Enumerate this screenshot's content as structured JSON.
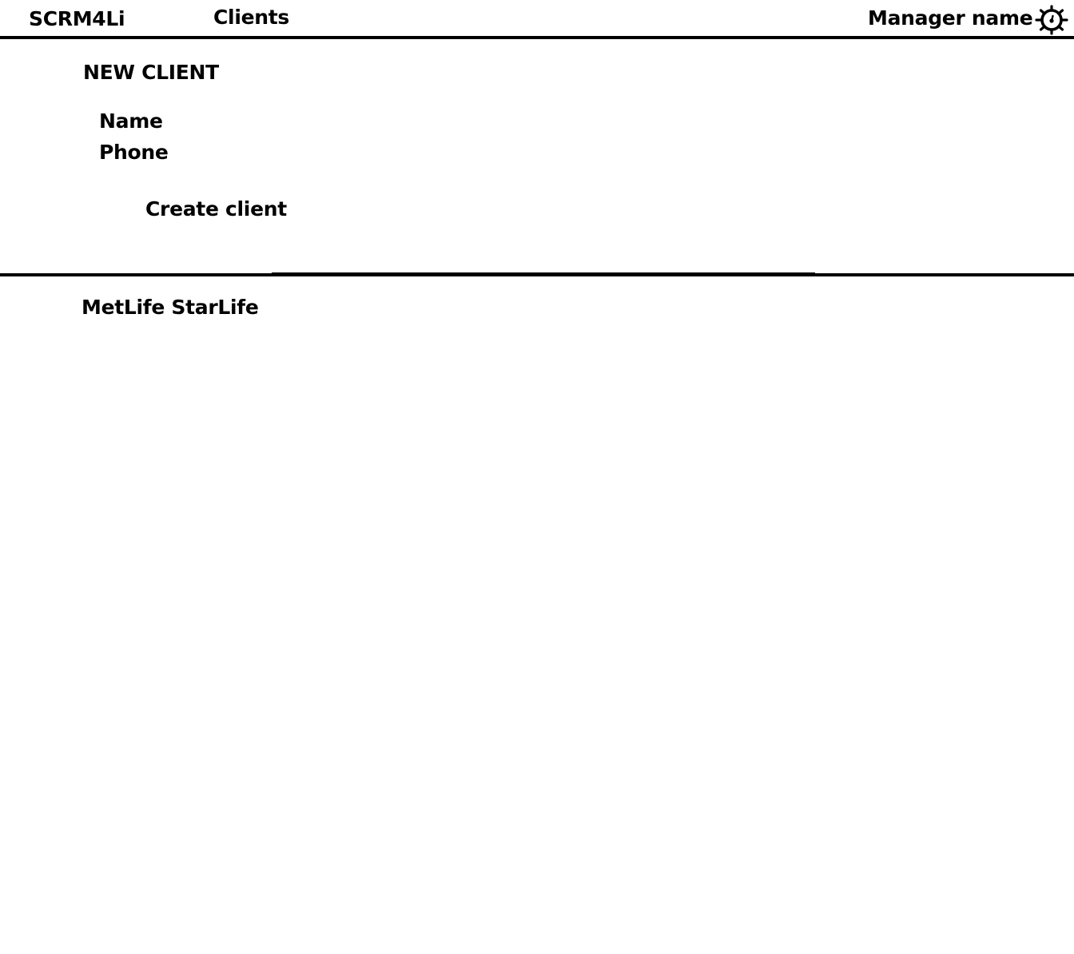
{
  "header": {
    "app_title": "SCRM4Li",
    "nav_clients": "Clients",
    "manager_name": "Manager name",
    "settings_icon": "gear-icon"
  },
  "new_client_form": {
    "title": "NEW CLIENT",
    "name_label": "Name",
    "phone_label": "Phone",
    "create_button": "Create client"
  },
  "clients_list": {
    "items": [
      {
        "label": "MetLife StarLife"
      }
    ]
  },
  "colors": {
    "text": "#000000",
    "background": "#ffffff",
    "lines": "#000000"
  }
}
